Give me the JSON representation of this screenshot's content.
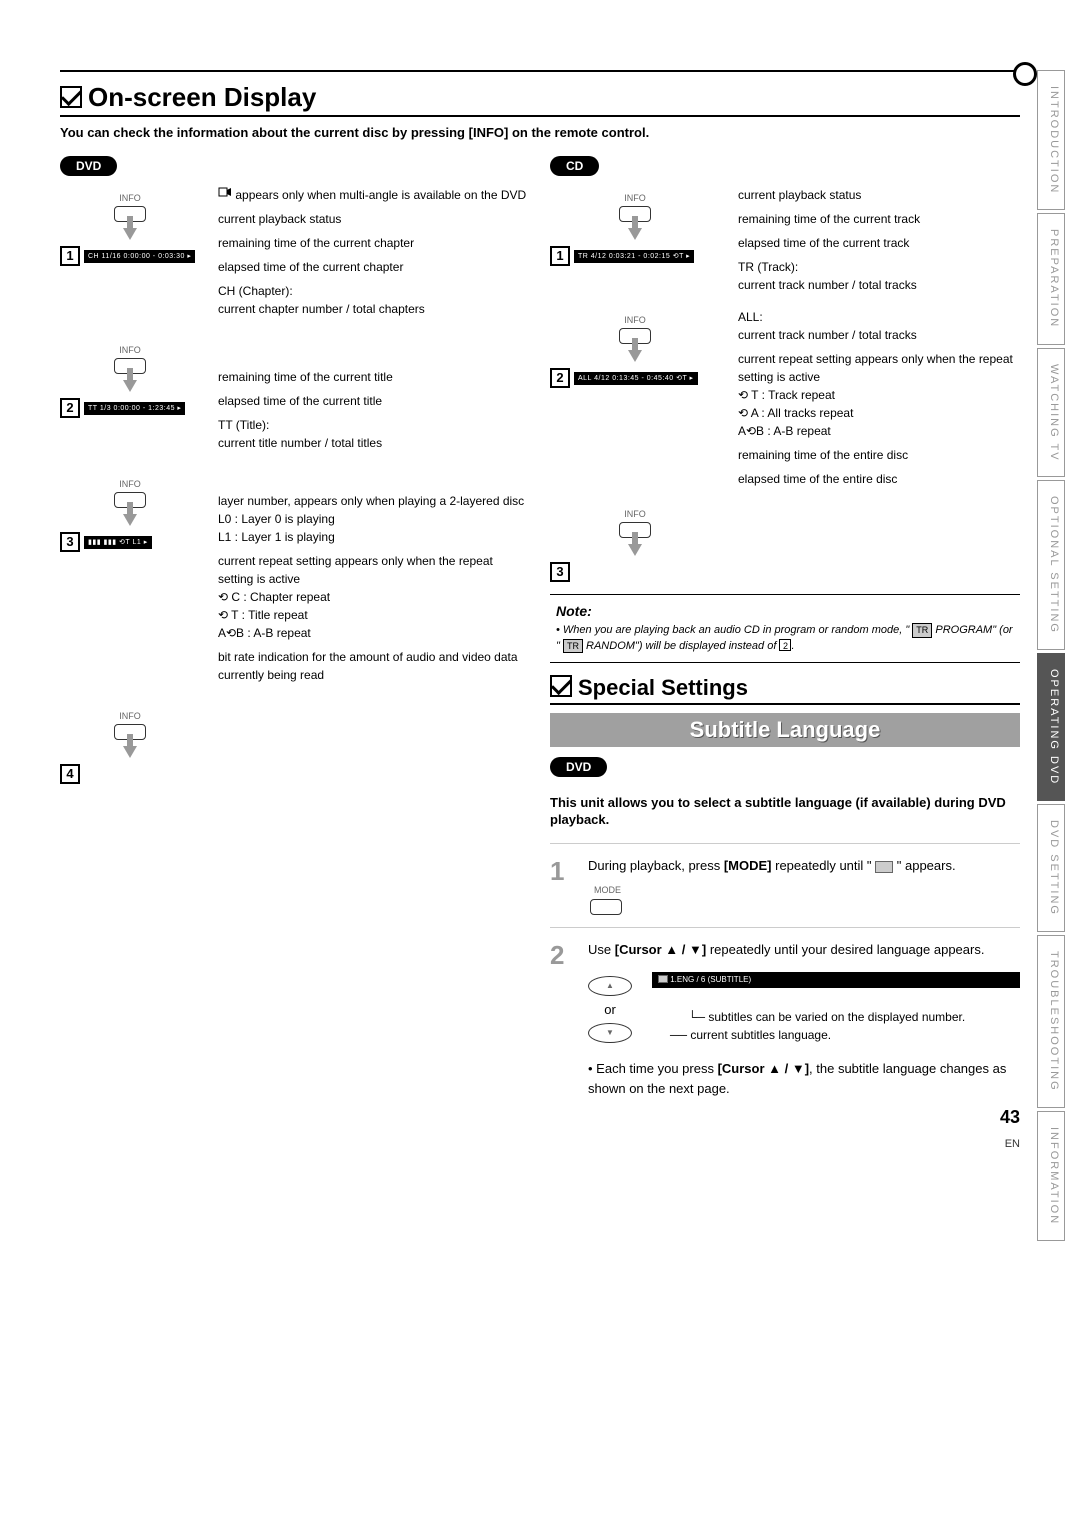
{
  "sideTabs": [
    "INTRODUCTION",
    "PREPARATION",
    "WATCHING  TV",
    "OPTIONAL  SETTING",
    "OPERATING  DVD",
    "DVD  SETTING",
    "TROUBLESHOOTING",
    "INFORMATION"
  ],
  "activeTabIndex": 4,
  "sections": {
    "osd": {
      "title": "On-screen Display",
      "intro_1": "You can check the information about the current disc by pressing ",
      "intro_bold": "[INFO]",
      "intro_2": " on the remote control."
    },
    "special": {
      "title": "Special Settings",
      "banner": "Subtitle Language",
      "intro": "This unit allows you to select a subtitle language (if available) during DVD playback."
    }
  },
  "labels": {
    "dvd": "DVD",
    "cd": "CD",
    "info": "INFO",
    "mode": "MODE",
    "or": "or",
    "note": "Note:"
  },
  "dvd": {
    "bar1": "CH  11/16  0:00:00 - 0:03:30  ▸",
    "desc1": [
      "appears only when multi-angle is available on the DVD",
      "current playback status",
      "remaining time of the current chapter",
      "elapsed time of the current chapter",
      "CH (Chapter):",
      "current chapter number / total chapters"
    ],
    "bar2": "TT  1/3  0:00:00 - 1:23:45  ▸",
    "desc2": [
      "remaining time of the current title",
      "elapsed time of the current title",
      "TT (Title):",
      "current title number / total titles"
    ],
    "bar3": "▮▮▮ ▮▮▮  ⟲T  L1  ▸",
    "desc3": [
      "layer number, appears only when playing a 2-layered disc",
      "L0 :   Layer 0 is playing",
      "L1 :   Layer 1 is playing",
      "current repeat setting appears only when the repeat setting is active",
      "⟲ C :   Chapter repeat",
      "⟲ T :   Title repeat",
      "A⟲B :  A-B repeat",
      "bit rate indication for the amount of audio and video data currently being read"
    ]
  },
  "cd": {
    "bar1": "TR  4/12  0:03:21 - 0:02:15  ⟲T  ▸",
    "desc1": [
      "current playback status",
      "remaining time of the current track",
      "elapsed time of the current track",
      "TR (Track):",
      "current track number / total tracks"
    ],
    "bar2": "ALL  4/12  0:13:45 - 0:45:40  ⟲T  ▸",
    "desc2": [
      "ALL:",
      "current track number / total tracks",
      "current repeat setting appears only when the repeat setting is active",
      "⟲ T :   Track repeat",
      "⟲ A :   All tracks repeat",
      "A⟲B :  A-B repeat",
      "remaining time of the entire disc",
      "elapsed time of the entire disc"
    ]
  },
  "note": {
    "text_1": "When you are playing back an audio CD in program or random mode, \" ",
    "tr": "TR",
    "text_2": " PROGRAM\" (or \" ",
    "text_3": " RANDOM\") will be displayed instead of ",
    "box": "2",
    "text_4": "."
  },
  "steps": {
    "s1_a": "During playback, press ",
    "s1_b": "[MODE]",
    "s1_c": " repeatedly until \" ",
    "s1_d": " \" appears.",
    "s2_a": "Use ",
    "s2_b": "[Cursor ▲ / ▼]",
    "s2_c": " repeatedly until your desired language appears.",
    "sub_display": "1.ENG / 6  (SUBTITLE)",
    "callout_1": "subtitles can be varied on the displayed number.",
    "callout_2": "current subtitles language.",
    "bullet_a": "Each time you press ",
    "bullet_b": "[Cursor ▲ / ▼]",
    "bullet_c": ", the subtitle language changes as shown on the next page."
  },
  "pageNum": "43",
  "langCode": "EN"
}
